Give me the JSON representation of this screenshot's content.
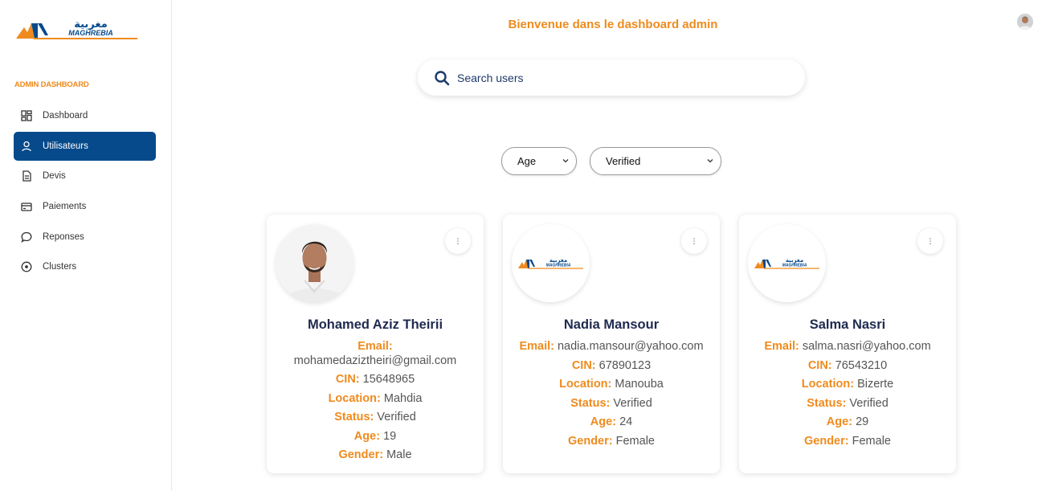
{
  "brand": {
    "logo_text": "MAGHREBIA",
    "logo_arabic": "مغربية",
    "accent": "#ef8b1e",
    "primary": "#074a8b"
  },
  "sidebar": {
    "section_title": "ADMIN DASHBOARD",
    "items": [
      {
        "label": "Dashboard",
        "icon": "dashboard-grid-icon",
        "active": false
      },
      {
        "label": "Utilisateurs",
        "icon": "user-icon",
        "active": true
      },
      {
        "label": "Devis",
        "icon": "document-icon",
        "active": false
      },
      {
        "label": "Paiements",
        "icon": "credit-card-icon",
        "active": false
      },
      {
        "label": "Reponses",
        "icon": "chat-bubble-icon",
        "active": false
      },
      {
        "label": "Clusters",
        "icon": "circle-dot-icon",
        "active": false
      }
    ]
  },
  "header": {
    "welcome": "Bienvenue dans le dashboard admin"
  },
  "search": {
    "placeholder": "Search users",
    "value": ""
  },
  "filters": {
    "age": {
      "selected": "Age"
    },
    "verified": {
      "selected": "Verified"
    }
  },
  "labels": {
    "email": "Email:",
    "cin": "CIN:",
    "location": "Location:",
    "status": "Status:",
    "age": "Age:",
    "gender": "Gender:"
  },
  "users": [
    {
      "name": "Mohamed Aziz Theirii",
      "email": "mohamedaziztheiri@gmail.com",
      "cin": "15648965",
      "location": "Mahdia",
      "status": "Verified",
      "age": "19",
      "gender": "Male",
      "photo": "person-photo"
    },
    {
      "name": "Nadia Mansour",
      "email": "nadia.mansour@yahoo.com",
      "cin": "67890123",
      "location": "Manouba",
      "status": "Verified",
      "age": "24",
      "gender": "Female",
      "photo": "maghrebia-logo"
    },
    {
      "name": "Salma Nasri",
      "email": "salma.nasri@yahoo.com",
      "cin": "76543210",
      "location": "Bizerte",
      "status": "Verified",
      "age": "29",
      "gender": "Female",
      "photo": "maghrebia-logo"
    }
  ]
}
